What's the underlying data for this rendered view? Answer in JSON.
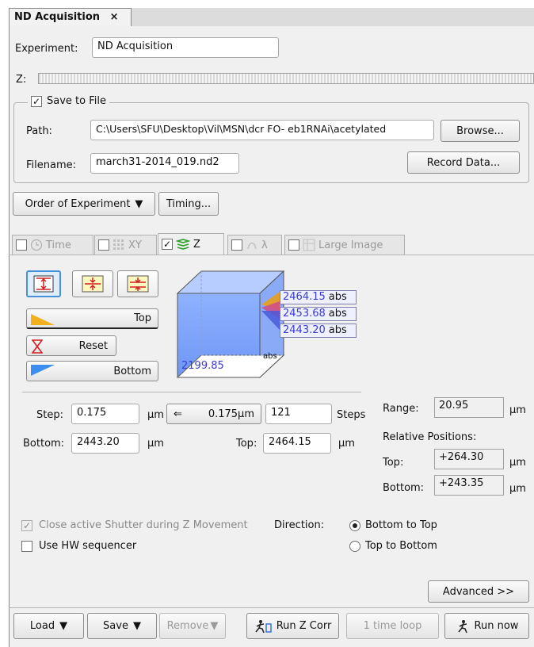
{
  "window": {
    "tab_title": "ND Acquisition",
    "tab_close": "×"
  },
  "experiment": {
    "label": "Experiment:",
    "value": "ND Acquisition"
  },
  "z_row": {
    "label": "Z:"
  },
  "save_to_file": {
    "label": "Save to File",
    "checked": true,
    "path_label": "Path:",
    "path_value": "C:\\Users\\SFU\\Desktop\\Vil\\MSN\\dcr FO- eb1RNAi\\acetylated",
    "browse": "Browse...",
    "filename_label": "Filename:",
    "filename_value": "march31-2014_019.nd2",
    "record": "Record Data..."
  },
  "order_button": "Order of Experiment",
  "timing_button": "Timing...",
  "dim_tabs": [
    {
      "label": "Time",
      "checked": false,
      "icon": "clock-icon"
    },
    {
      "label": "XY",
      "checked": false,
      "icon": "grid-icon"
    },
    {
      "label": "Z",
      "checked": true,
      "icon": "z-stack-icon"
    },
    {
      "label": "λ",
      "checked": false,
      "icon": "lambda-icon"
    },
    {
      "label": "Large Image",
      "checked": false,
      "icon": "large-image-icon"
    }
  ],
  "z_panel": {
    "top_btn": "Top",
    "reset_btn": "Reset",
    "bottom_btn": "Bottom",
    "abs_values": [
      "2464.15",
      "2453.68",
      "2443.20"
    ],
    "abs_unit": "abs",
    "cube_bottom_value": "2199.85",
    "cube_bottom_unit": "abs"
  },
  "step": {
    "label": "Step:",
    "value": "0.175",
    "unit": "µm",
    "arrow": "⇐",
    "computed": "0.175µm",
    "steps_value": "121",
    "steps_label": "Steps"
  },
  "bottom": {
    "label": "Bottom:",
    "value": "2443.20",
    "unit": "µm"
  },
  "top": {
    "label": "Top:",
    "value": "2464.15",
    "unit": "µm"
  },
  "range": {
    "label": "Range:",
    "value": "20.95",
    "unit": "µm"
  },
  "relative": {
    "title": "Relative Positions:",
    "top_label": "Top:",
    "top_value": "+264.30",
    "top_unit": "µm",
    "bottom_label": "Bottom:",
    "bottom_value": "+243.35",
    "bottom_unit": "µm"
  },
  "options": {
    "close_shutter": "Close active Shutter during Z Movement",
    "hw_sequencer": "Use HW sequencer",
    "direction_label": "Direction:",
    "dir_bottom_top": "Bottom to Top",
    "dir_top_bottom": "Top to Bottom"
  },
  "advanced": "Advanced >>",
  "footer": {
    "load": "Load",
    "save": "Save",
    "remove": "Remove",
    "run_z_corr": "Run Z Corr",
    "time_loop": "1 time loop",
    "run_now": "Run now"
  },
  "colors": {
    "accent": "#3b3bd0",
    "cube": "#7fa6ff"
  }
}
